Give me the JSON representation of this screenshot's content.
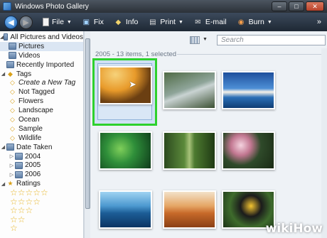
{
  "window": {
    "title": "Windows Photo Gallery"
  },
  "toolbar": {
    "items": [
      {
        "label": "File",
        "icon": "file-icon",
        "has_menu": true
      },
      {
        "label": "Fix",
        "icon": "fix-icon",
        "has_menu": false
      },
      {
        "label": "Info",
        "icon": "info-tag-icon",
        "has_menu": false
      },
      {
        "label": "Print",
        "icon": "printer-icon",
        "has_menu": true
      },
      {
        "label": "E-mail",
        "icon": "email-icon",
        "has_menu": false
      },
      {
        "label": "Burn",
        "icon": "disc-icon",
        "has_menu": true
      }
    ],
    "more": "»"
  },
  "sidebar": {
    "all_pictures": "All Pictures and Videos",
    "pictures": "Pictures",
    "videos": "Videos",
    "recently_imported": "Recently Imported",
    "tags": "Tags",
    "create_tag": "Create a New Tag",
    "not_tagged": "Not Tagged",
    "tag_items": [
      "Flowers",
      "Landscape",
      "Ocean",
      "Sample",
      "Wildlife"
    ],
    "date_taken": "Date Taken",
    "years": [
      "2004",
      "2005",
      "2006"
    ],
    "ratings": "Ratings"
  },
  "main": {
    "search_placeholder": "Search",
    "group_label": "2005 - 13 items, 1 selected",
    "help": "?"
  },
  "watermark": {
    "wiki": "wiki",
    "how": "How"
  },
  "colors": {
    "selection_highlight": "#2ed12e",
    "toolbar_bg": "#1e2834"
  }
}
